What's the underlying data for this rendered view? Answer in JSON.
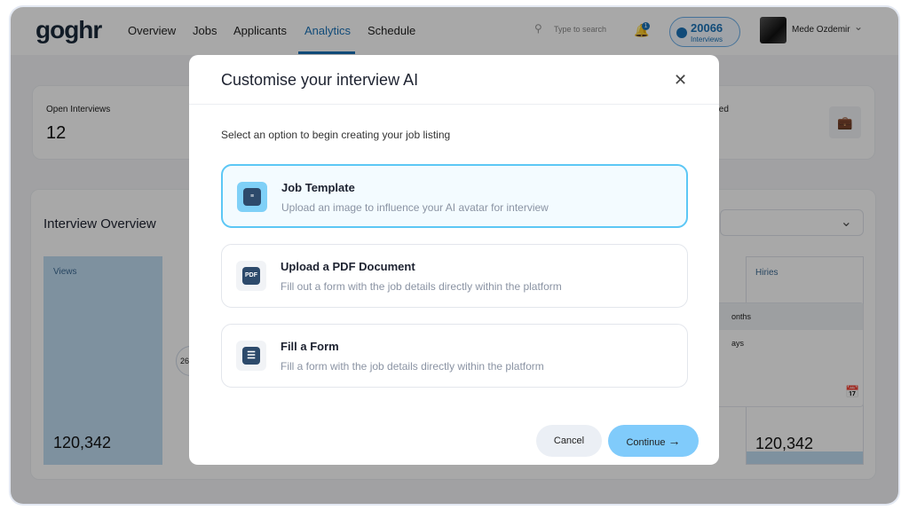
{
  "header": {
    "logo": "goghr",
    "nav": [
      "Overview",
      "Jobs",
      "Applicants",
      "Analytics",
      "Schedule"
    ],
    "active_nav": "Analytics",
    "search_placeholder": "Type to search",
    "notification_count": "1",
    "interviews_count": "20066",
    "interviews_label": "Interviews",
    "user_name": "Mede Ozdemir"
  },
  "stats": {
    "open_interviews_label": "Open Interviews",
    "open_interviews_value": "12",
    "partial_label": "ted"
  },
  "overview": {
    "title": "Interview Overview",
    "views_label": "Views",
    "views_value": "120,342",
    "circle_value": "26.",
    "hiries_label": "Hiries",
    "hiries_value": "120,342",
    "menu_items": [
      "onths",
      "ays"
    ]
  },
  "modal": {
    "title": "Customise your interview AI",
    "subtitle": "Select an option to begin creating your job listing",
    "options": [
      {
        "title": "Job Template",
        "desc": "Upload an image to influence your AI avatar for interview",
        "icon": "document-icon",
        "selected": true
      },
      {
        "title": "Upload a PDF Document",
        "desc": "Fill out a form with the job details directly within the platform",
        "icon": "pdf-icon",
        "icon_text": "PDF"
      },
      {
        "title": "Fill a Form",
        "desc": "Fill a form with the job details directly within the platform",
        "icon": "list-icon"
      }
    ],
    "cancel": "Cancel",
    "continue": "Continue",
    "accent": "#5cc7f5"
  }
}
